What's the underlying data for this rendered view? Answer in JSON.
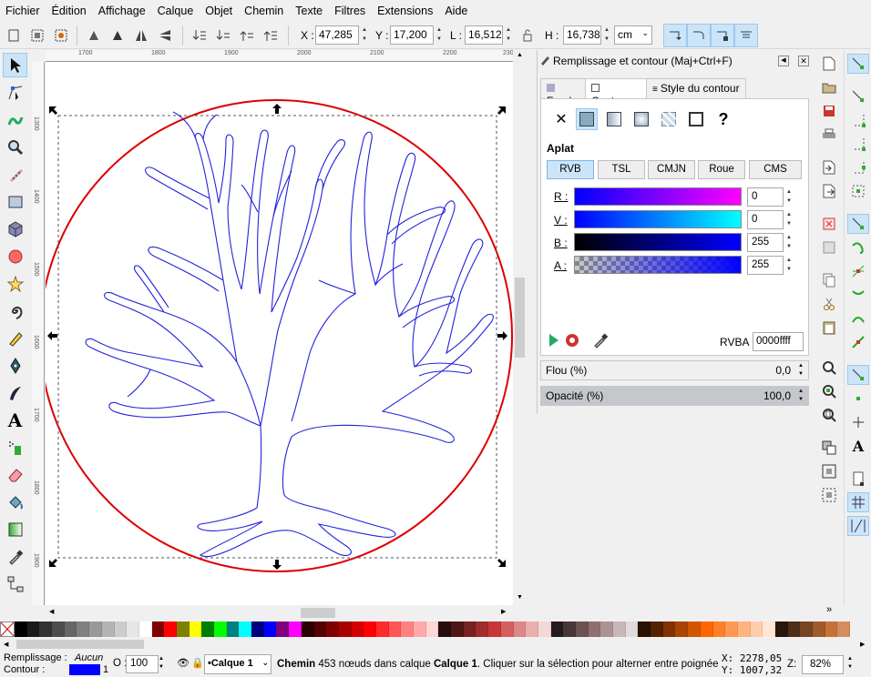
{
  "menu": [
    "Fichier",
    "Édition",
    "Affichage",
    "Calque",
    "Objet",
    "Chemin",
    "Texte",
    "Filtres",
    "Extensions",
    "Aide"
  ],
  "controls": {
    "x_label": "X :",
    "x_value": "47,285",
    "y_label": "Y :",
    "y_value": "17,200",
    "w_label": "L :",
    "w_value": "16,512",
    "h_label": "H :",
    "h_value": "16,738",
    "unit": "cm"
  },
  "rulers": {
    "h_ticks": [
      "1700",
      "1800",
      "1900",
      "2000",
      "2100",
      "2200",
      "2300"
    ],
    "v_ticks": [
      "1300",
      "1400",
      "1500",
      "1600",
      "1700",
      "1800",
      "1900",
      "2000"
    ]
  },
  "dialog": {
    "title": "Remplissage et contour (Maj+Ctrl+F)",
    "tabs": [
      "Fond",
      "Contour",
      "Style du contour"
    ],
    "paint_help": "?",
    "flat_label": "Aplat",
    "modes": [
      "RVB",
      "TSL",
      "CMJN",
      "Roue",
      "CMS"
    ],
    "channels": [
      {
        "label": "R :",
        "value": "0"
      },
      {
        "label": "V :",
        "value": "0"
      },
      {
        "label": "B :",
        "value": "255"
      },
      {
        "label": "A :",
        "value": "255"
      }
    ],
    "rgba_label": "RVBA :",
    "rgba_value": "0000ffff",
    "blur_label": "Flou (%)",
    "blur_value": "0,0",
    "opacity_label": "Opacité (%)",
    "opacity_value": "100,0"
  },
  "colors": {
    "stroke": "#0000ff",
    "circle": "#dd0000",
    "accent": "#cce4f7"
  },
  "palette": [
    "#000000",
    "#1a1a1a",
    "#333333",
    "#4d4d4d",
    "#666666",
    "#808080",
    "#999999",
    "#b3b3b3",
    "#cccccc",
    "#e6e6e6",
    "#ffffff",
    "#800000",
    "#ff0000",
    "#808000",
    "#ffff00",
    "#008000",
    "#00ff00",
    "#008080",
    "#00ffff",
    "#000080",
    "#0000ff",
    "#800080",
    "#ff00ff",
    "#2b0000",
    "#550000",
    "#800000",
    "#aa0000",
    "#d40000",
    "#ff0000",
    "#ff2a2a",
    "#ff5555",
    "#ff8080",
    "#ffaaaa",
    "#ffd5d5",
    "#280b0b",
    "#501616",
    "#782121",
    "#a02c2c",
    "#c83737",
    "#d35f5f",
    "#de8787",
    "#e9afaf",
    "#f4d7d7",
    "#241c1c",
    "#483737",
    "#6c5353",
    "#916f6f",
    "#ac9393",
    "#c8b7b7",
    "#e3dbdb",
    "#2b1100",
    "#552200",
    "#803300",
    "#aa4400",
    "#d45500",
    "#ff6600",
    "#ff7f2a",
    "#ff9955",
    "#ffb380",
    "#ffccaa",
    "#ffe6d5",
    "#28170b",
    "#502d16",
    "#784421",
    "#a05a2c",
    "#c87137",
    "#d38d5f"
  ],
  "status": {
    "fill_label": "Remplissage :",
    "fill_value": "Aucun",
    "stroke_label": "Contour :",
    "stroke_width": "1",
    "opacity_label": "O :",
    "opacity_value": "100",
    "layer": "•Calque 1",
    "message_bold1": "Chemin",
    "message_mid": " 453 nœuds dans calque ",
    "message_bold2": "Calque 1",
    "message_end": ". Cliquer sur la sélection pour alterner entre poignées",
    "cursor_x": "X: 2278,05",
    "cursor_y": "Y: 1007,32",
    "zoom_label": "Z:",
    "zoom_value": "82%"
  }
}
